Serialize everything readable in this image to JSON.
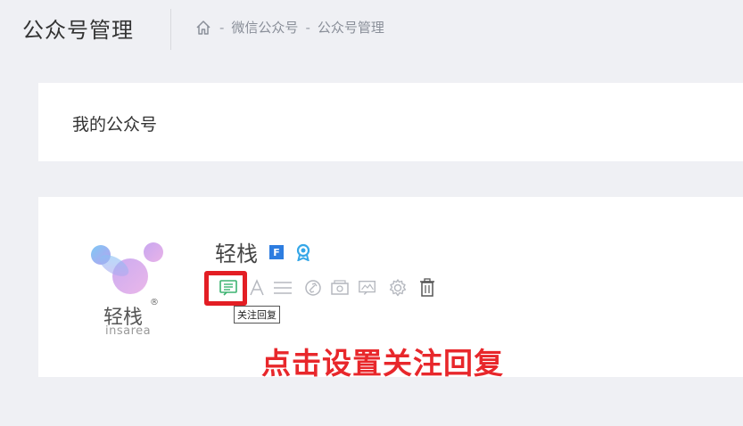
{
  "header": {
    "title": "公众号管理",
    "breadcrumb": {
      "home_icon": "home-icon",
      "separator": "-",
      "items": [
        "微信公众号",
        "公众号管理"
      ]
    }
  },
  "section": {
    "title": "我的公众号"
  },
  "account": {
    "name": "轻栈",
    "logo": {
      "text": "轻栈",
      "registered": "®",
      "subtext": "insarea"
    },
    "badges": {
      "f_label": "F",
      "certified_icon": "certified-icon"
    },
    "toolbar": {
      "icons": [
        "follow-reply-icon",
        "text-icon",
        "menu-icon",
        "link-icon",
        "media-icon",
        "image-text-icon",
        "gear-icon",
        "delete-icon"
      ],
      "tooltip": "关注回复"
    },
    "hint": "点击设置关注回复"
  },
  "colors": {
    "background": "#eff0f4",
    "card": "#ffffff",
    "highlight": "#e31e24",
    "badge_blue": "#2d7de0",
    "icon_active": "#3cb371",
    "icon_muted": "#b5b8bf"
  }
}
